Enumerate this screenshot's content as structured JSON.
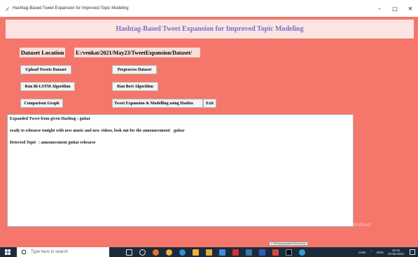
{
  "window": {
    "title": "Hashtag-Based Tweet Expansion for Improved Topic Modeling",
    "controls": {
      "minimize": "–",
      "maximize": "□",
      "close": "✕"
    }
  },
  "header": {
    "title": "Hashtag-Based Tweet Expansion for Improved Topic Modeling"
  },
  "dataset": {
    "label": "Dataset Location",
    "path": "E:/venkat/2021/May23/TweetExpansion/Dataset/"
  },
  "buttons": {
    "upload": "Upload Tweets Dataset",
    "preprocess": "Preprocess Dataset",
    "bilstm": "Run Bi-LSTM Algorithm",
    "bert": "Run Bert Algorithm",
    "comparison": "Comparison Graph",
    "expansion": "Tweet Expansion & Modelling using Hashta",
    "exit": "Exit"
  },
  "output": {
    "line1": "Expanded Tweet from given Hashtag : guitar",
    "line2": "ready to rehearse tonight with new music and new videos, look out for the announcement!   guitar",
    "line3": "Detected Topic  : announcement guitar rehearse"
  },
  "watermark": "Activate Windows",
  "cmd_tooltip": "C:\\Windows\\system32\\cmd.exe",
  "taskbar": {
    "search_placeholder": "Type here to search",
    "icons": [
      "task-view-icon",
      "cortana-icon",
      "firefox-icon",
      "chrome-icon",
      "edge-icon",
      "store-icon",
      "explorer-icon",
      "paint-icon",
      "acrobat-icon",
      "python-icon",
      "word-icon",
      "tool-icon",
      "cmd-icon",
      "browser-icon"
    ],
    "tray": {
      "links": "Links",
      "language": "ENG",
      "time": "15:34",
      "date": "22-05-2022"
    }
  },
  "colors": {
    "background": "#f5776b",
    "header_band": "#fbe4e2",
    "header_text": "#7b6ec8",
    "taskbar": "#1c2b3c"
  }
}
